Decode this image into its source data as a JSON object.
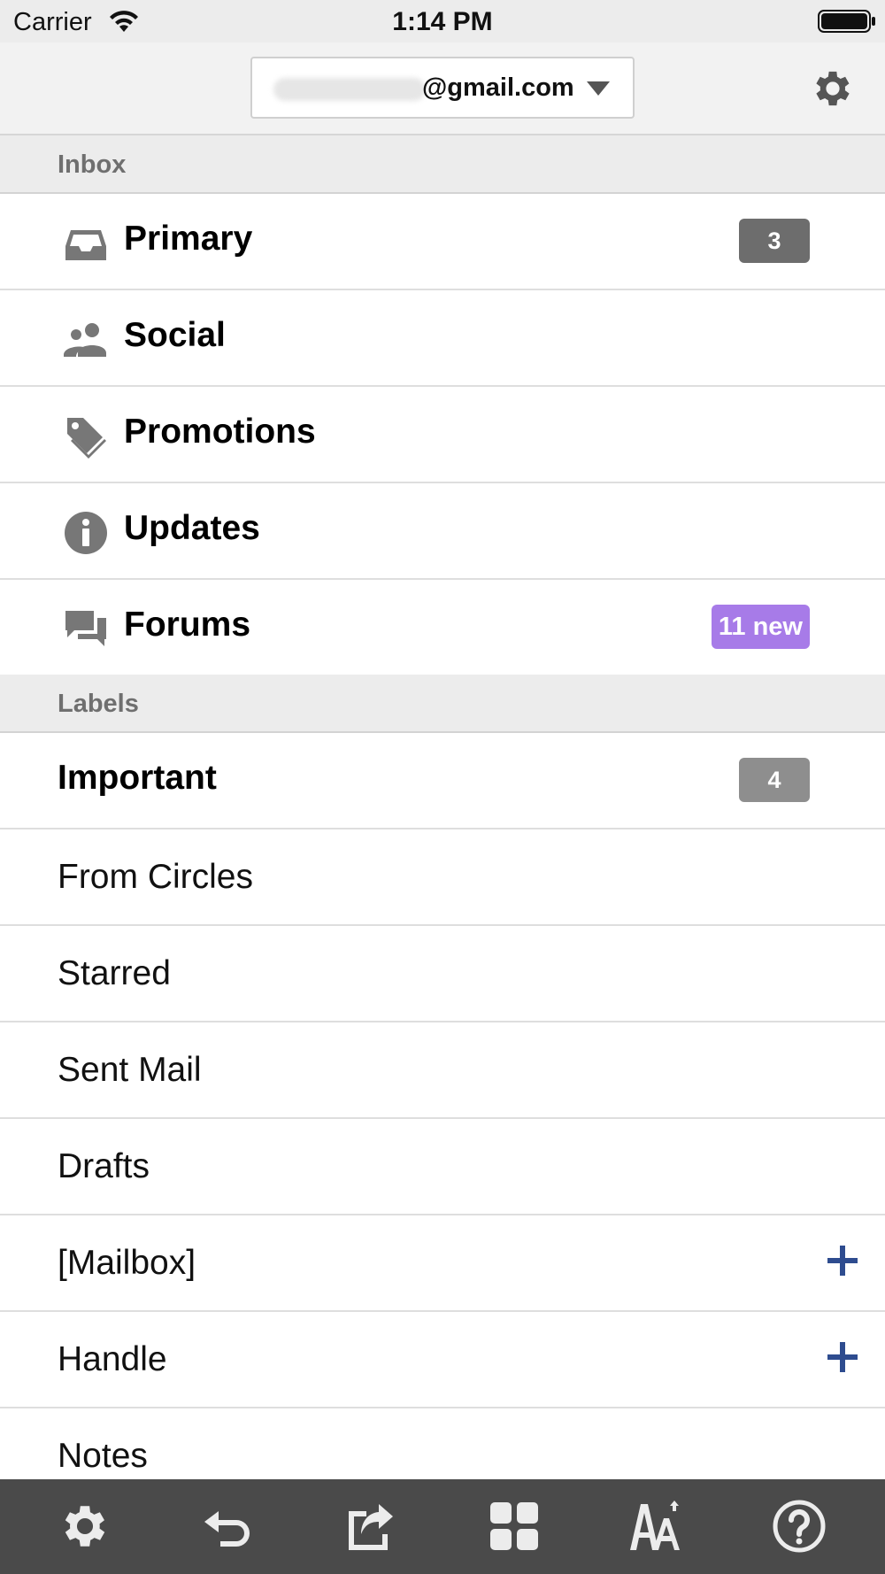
{
  "status_bar": {
    "carrier": "Carrier",
    "time": "1:14 PM"
  },
  "account": {
    "email": "@gmail.com"
  },
  "inbox": {
    "title": "Inbox",
    "items": [
      {
        "label": "Primary",
        "icon": "inbox-tray-icon",
        "badge": "3"
      },
      {
        "label": "Social",
        "icon": "people-icon"
      },
      {
        "label": "Promotions",
        "icon": "tag-icon"
      },
      {
        "label": "Updates",
        "icon": "info-icon"
      },
      {
        "label": "Forums",
        "icon": "chat-bubbles-icon",
        "badge": "11 new"
      }
    ]
  },
  "labels": {
    "title": "Labels",
    "items": [
      {
        "label": "Important",
        "badge": "4"
      },
      {
        "label": "From Circles"
      },
      {
        "label": "Starred"
      },
      {
        "label": "Sent Mail"
      },
      {
        "label": "Drafts"
      },
      {
        "label": "[Mailbox]",
        "action": "plus-icon"
      },
      {
        "label": "Handle",
        "action": "plus-icon"
      },
      {
        "label": "Notes"
      }
    ]
  },
  "toolbar": {
    "icons": [
      "gear-icon",
      "back-arrow-icon",
      "share-icon",
      "grid-icon",
      "text-size-icon",
      "help-icon"
    ]
  },
  "colors": {
    "primary_badge": "#6d6d6d",
    "forums_badge": "#a77be8",
    "important_badge": "#8e8e8e",
    "plus": "#2e4c8f",
    "toolbar": "#4a4a4a",
    "section_bg": "#ececec"
  }
}
